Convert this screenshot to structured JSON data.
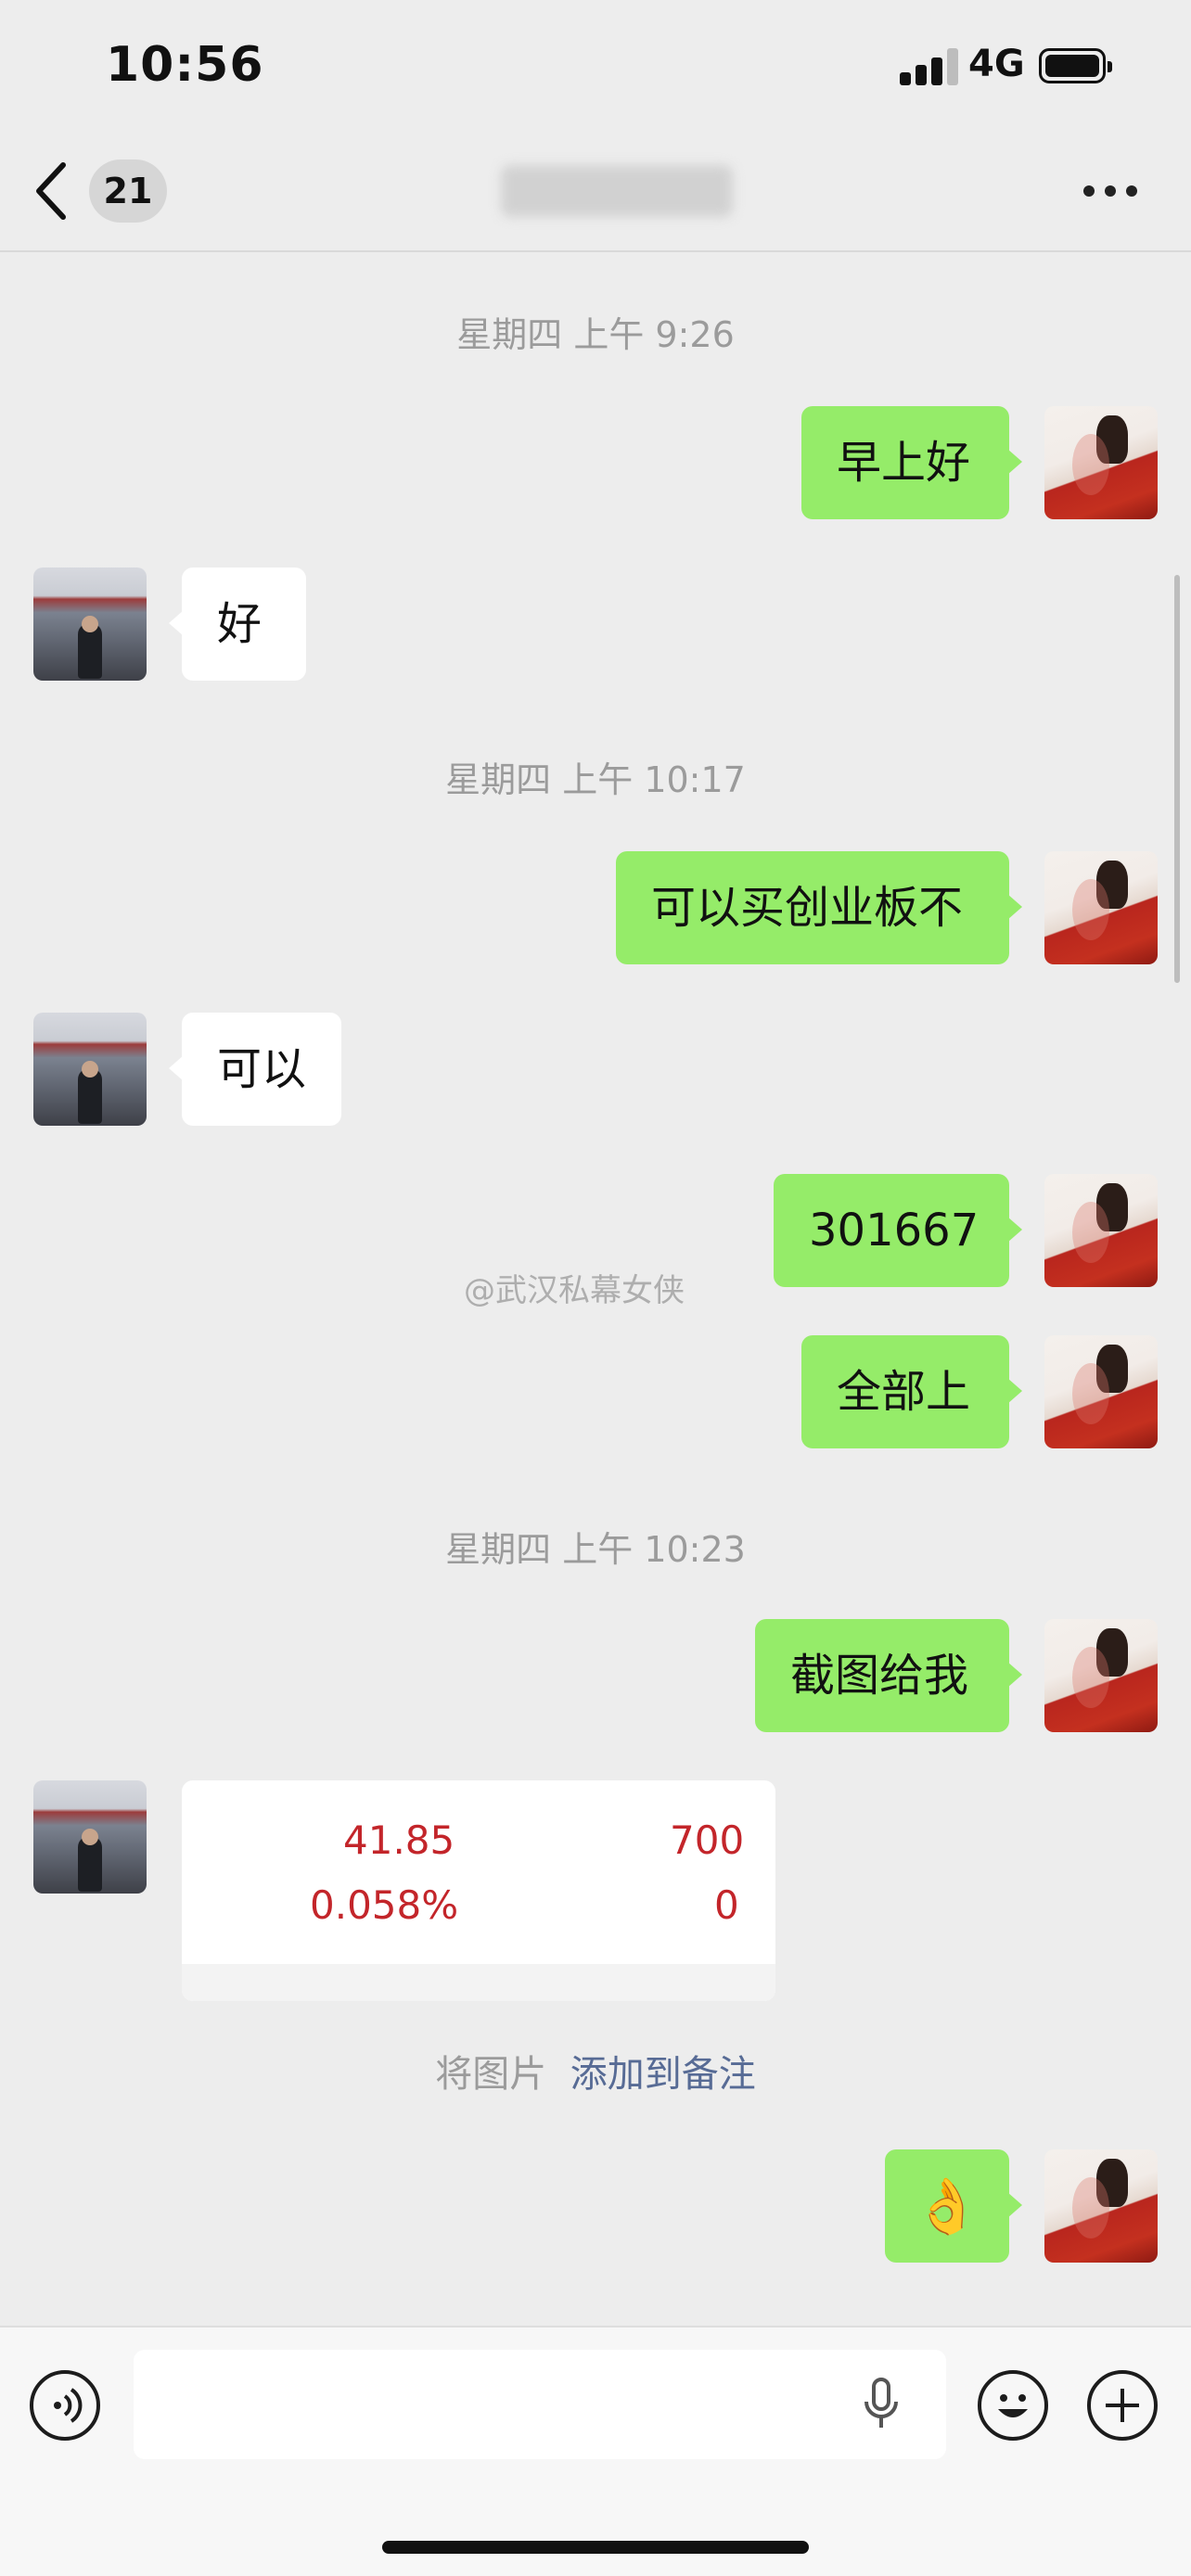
{
  "status_bar": {
    "time": "10:56",
    "network": "4G"
  },
  "nav": {
    "unread_count": "21",
    "title": ""
  },
  "messages": {
    "ts1": "星期四 上午 9:26",
    "m1": "早上好",
    "m2": "好",
    "ts2": "星期四 上午 10:17",
    "m3": "可以买创业板不",
    "m4": "可以",
    "m5": "301667",
    "m6": "全部上",
    "ts3": "星期四 上午 10:23",
    "m7": "截图给我",
    "image": {
      "price": "41.85",
      "percent": "0.058%",
      "qty": "700",
      "zero": "0"
    },
    "hint_prefix": "将图片",
    "hint_link": "添加到备注",
    "m8": "👌"
  },
  "watermark": "@武汉私幕女侠",
  "icons": {
    "back": "chevron-left-icon",
    "more": "more-dots-icon",
    "voice": "voice-mode-icon",
    "mic": "microphone-icon",
    "emoji": "emoji-icon",
    "plus": "add-icon"
  },
  "colors": {
    "sent_bubble": "#95ec69",
    "received_bubble": "#ffffff",
    "link": "#576b95",
    "stock_red": "#c3252a"
  }
}
